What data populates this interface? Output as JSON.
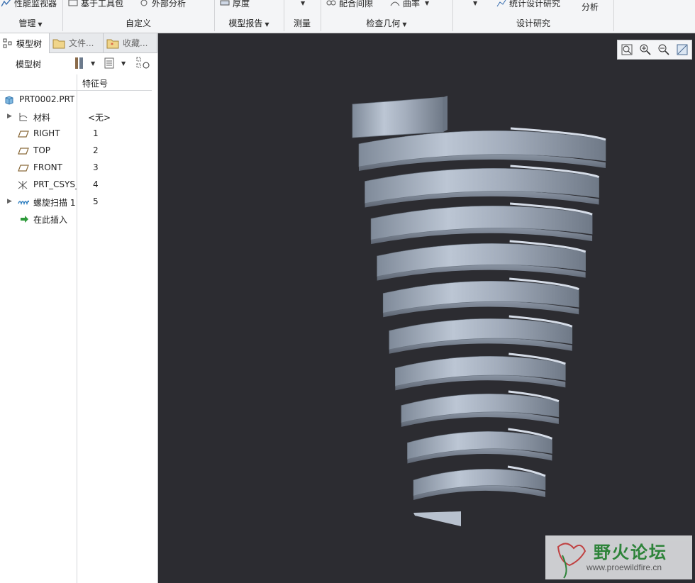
{
  "ribbon": {
    "top_items": [
      {
        "label": "性能监视器",
        "icon": "performance-monitor-icon"
      },
      {
        "label": "基于工具包",
        "icon": "toolkit-icon"
      },
      {
        "label": "外部分析",
        "icon": "external-analysis-icon"
      },
      {
        "label": "厚度",
        "icon": "thickness-icon"
      },
      {
        "label": "配合间隙",
        "icon": "clearance-icon"
      },
      {
        "label": "曲率",
        "icon": "curvature-icon"
      },
      {
        "label": "统计设计研究",
        "icon": "statistical-study-icon"
      },
      {
        "label": "分析",
        "icon": "analysis-icon"
      }
    ],
    "groups": {
      "manage": "管理",
      "custom": "自定义",
      "model_report": "模型报告",
      "measure": "测量",
      "inspect_geometry": "检查几何",
      "design_study": "设计研究"
    }
  },
  "panel": {
    "tabs": {
      "model_tree": "模型树",
      "files": "文件...",
      "favorites": "收藏..."
    },
    "toolbar_label": "模型树",
    "column_header": "特征号",
    "root": "PRT0002.PRT",
    "rows": [
      {
        "label": "材料",
        "number": "<无>",
        "icon": "material-icon",
        "expandable": true
      },
      {
        "label": "RIGHT",
        "number": "1",
        "icon": "datum-plane-icon",
        "expandable": false
      },
      {
        "label": "TOP",
        "number": "2",
        "icon": "datum-plane-icon",
        "expandable": false
      },
      {
        "label": "FRONT",
        "number": "3",
        "icon": "datum-plane-icon",
        "expandable": false
      },
      {
        "label": "PRT_CSYS_DEF",
        "number": "4",
        "icon": "coordinate-system-icon",
        "expandable": false
      },
      {
        "label": "螺旋扫描 1",
        "number": "5",
        "icon": "helical-sweep-icon",
        "expandable": true
      },
      {
        "label": "在此插入",
        "number": "",
        "icon": "insert-here-arrow-icon",
        "expandable": false
      }
    ]
  },
  "view_toolbar": [
    "zoom-fit-icon",
    "zoom-in-icon",
    "zoom-out-icon",
    "repaint-icon"
  ],
  "watermark": {
    "title": "野火论坛",
    "url": "www.proewildfire.cn"
  },
  "colors": {
    "viewport_bg": "#2c2c31",
    "model_surface": "#a9b3c2",
    "ribbon_bg": "#f4f5f7"
  }
}
